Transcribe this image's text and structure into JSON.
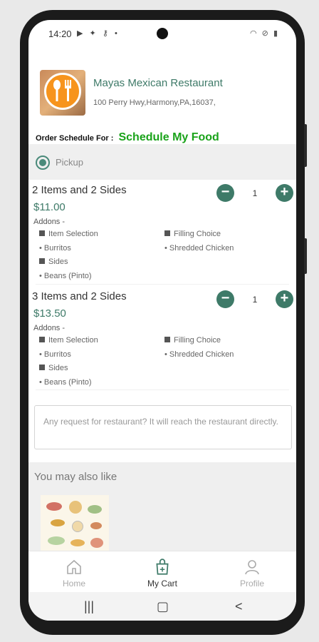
{
  "status_bar": {
    "time": "14:20",
    "left_icons": [
      "play-icon",
      "android-icon",
      "key-icon",
      "dot-icon"
    ],
    "right_icons": [
      "wifi-icon",
      "dnd-icon",
      "battery-icon"
    ]
  },
  "restaurant": {
    "name": "Mayas Mexican Restaurant",
    "address": "100 Perry Hwy,Harmony,PA,16037,"
  },
  "schedule": {
    "label": "Order Schedule For :",
    "link": "Schedule My Food"
  },
  "order_type": {
    "selected": "Pickup"
  },
  "cart_items": [
    {
      "title": "2 Items and 2 Sides",
      "price": "$11.00",
      "quantity": "1",
      "addons_label": "Addons -",
      "left": [
        "Item Selection",
        "Burritos",
        "Sides",
        "Beans (Pinto)"
      ],
      "right": [
        "Filling Choice",
        "Shredded Chicken"
      ]
    },
    {
      "title": "3 Items and 2 Sides",
      "price": "$13.50",
      "quantity": "1",
      "addons_label": "Addons -",
      "left": [
        "Item Selection",
        "Burritos",
        "Sides",
        "Beans (Pinto)"
      ],
      "right": [
        "Filling Choice",
        "Shredded Chicken"
      ]
    }
  ],
  "request": {
    "placeholder": "Any request for restaurant? It will reach the restaurant directly."
  },
  "recommendations": {
    "title": "You may also like"
  },
  "bottom_nav": [
    {
      "label": "Home",
      "icon": "home-icon",
      "active": false
    },
    {
      "label": "My Cart",
      "icon": "cart-icon",
      "active": true
    },
    {
      "label": "Profile",
      "icon": "profile-icon",
      "active": false
    }
  ],
  "colors": {
    "accent": "#3e7a68",
    "link_green": "#1aa31a",
    "logo_orange": "#f7941d",
    "muted": "#888888"
  }
}
